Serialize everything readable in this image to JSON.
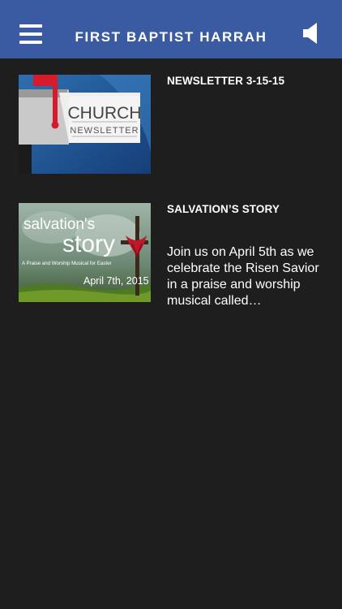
{
  "header": {
    "title": "FIRST BAPTIST HARRAH",
    "menu_icon": "hamburger-menu-icon",
    "audio_icon": "speaker-icon"
  },
  "feed": [
    {
      "title": "NEWSLETTER 3-15-15",
      "summary": "",
      "thumb": {
        "word1": "CHURCH",
        "word2": "NEWSLETTER",
        "icon": "mailbox-icon"
      }
    },
    {
      "title": "SALVATION’S STORY",
      "summary": "Join us on April 5th as we celebrate the Risen Savior in a praise and worship musical called…",
      "thumb": {
        "line1": "salvation's",
        "line2": "story",
        "subtitle": "A Praise and Worship Musical for Easter",
        "date": "April 7th, 2015",
        "icon": "cross-icon"
      }
    }
  ],
  "colors": {
    "header_bg": "#3a5ba1",
    "page_bg": "#1e1e1e",
    "text": "#ffffff"
  }
}
